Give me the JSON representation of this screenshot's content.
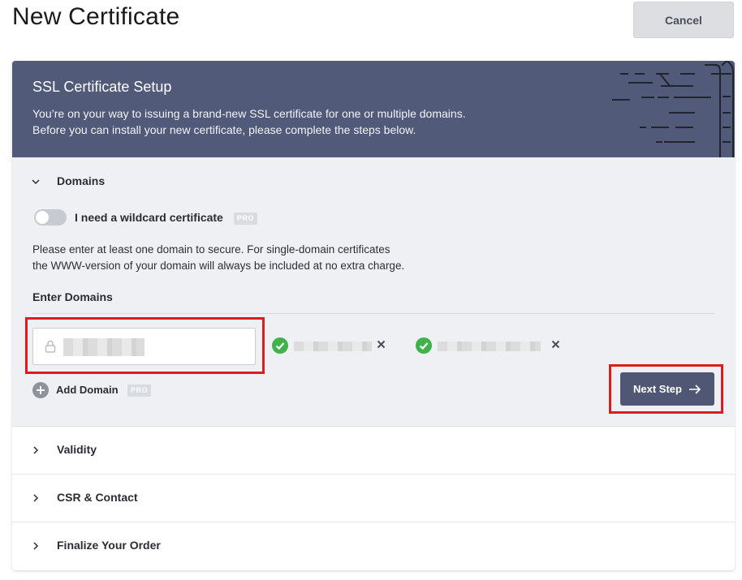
{
  "header": {
    "title": "New Certificate",
    "cancel_label": "Cancel"
  },
  "banner": {
    "title": "SSL Certificate Setup",
    "description": "You’re on your way to issuing a brand-new SSL certificate for one or multiple domains.\nBefore you can install your new certificate, please complete the steps below."
  },
  "domains_section": {
    "title": "Domains",
    "wildcard_label": "I need a wildcard certificate",
    "wildcard_enabled": false,
    "pro_badge": "PRO",
    "help_text": "Please enter at least one domain to secure. For single-domain certificates\nthe WWW-version of your domain will always be included at no extra charge.",
    "enter_label": "Enter Domains",
    "add_domain_label": "Add Domain",
    "next_label": "Next Step",
    "status_icon": "check-circle-icon",
    "remove_icon": "close-icon"
  },
  "sections": [
    {
      "label": "Validity"
    },
    {
      "label": "CSR & Contact"
    },
    {
      "label": "Finalize Your Order"
    }
  ],
  "colors": {
    "banner": "#515a78",
    "primary_button": "#4f5775",
    "success": "#3fb24b",
    "highlight": "#e01b1b"
  }
}
